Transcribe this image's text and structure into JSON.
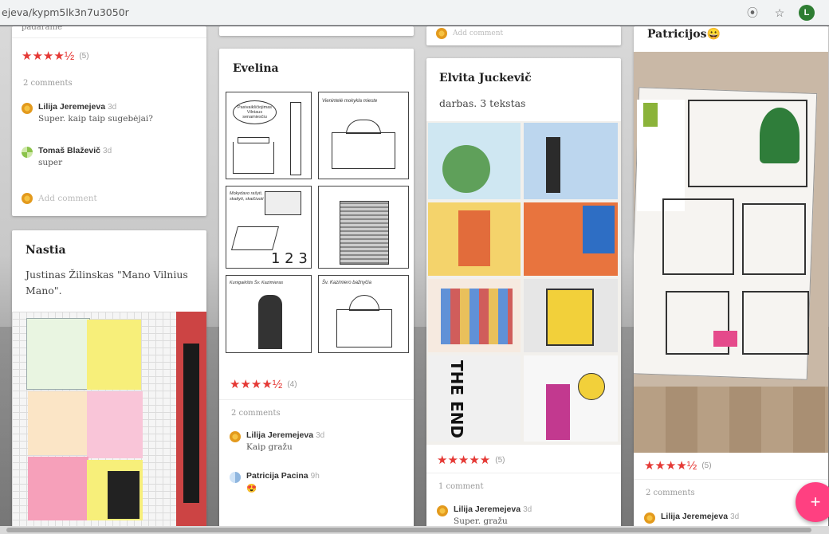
{
  "browser": {
    "url": "ejeva/kypm5lk3n7u3050r",
    "profile_initial": "L",
    "icons": [
      "history-icon",
      "star-icon",
      "profile-avatar"
    ]
  },
  "posts": {
    "top_left": {
      "partial_text": "padaranie",
      "stars": "★★★★½",
      "rating_count": "(5)",
      "comment_count": "2 comments",
      "comments": [
        {
          "author": "Lilija Jeremejeva",
          "time": "3d",
          "text": "Super. kaip taip sugebėjai?"
        },
        {
          "author": "Tomaš Blaževič",
          "time": "3d",
          "text": "super"
        }
      ],
      "add_comment": "Add comment"
    },
    "nastia": {
      "title": "Nastia",
      "text": "Justinas Žilinskas \"Mano Vilnius Mano\"."
    },
    "evelina": {
      "title": "Evelina",
      "panels": [
        "Pasivaikščiojimas Vilniaus senamiesčiu",
        "Vienintelė mokykla mieste",
        "Mokydavo rašyti, skaityti, skaičiuoti",
        "",
        "Kunigaikštis Šv. Kazimieras",
        "Šv. Kazimiero bažnyčia"
      ],
      "stars": "★★★★½",
      "rating_count": "(4)",
      "comment_count": "2 comments",
      "comments": [
        {
          "author": "Lilija Jeremejeva",
          "time": "3d",
          "text": "Kaip gražu"
        },
        {
          "author": "Patricija Pacina",
          "time": "9h",
          "text": "😍"
        }
      ]
    },
    "elvita": {
      "title": "Elvita Juckevič",
      "text": "darbas. 3 tekstas",
      "partial_text": "Add comment",
      "stars": "★★★★★",
      "rating_count": "(5)",
      "comment_count": "1 comment",
      "comments": [
        {
          "author": "Lilija Jeremejeva",
          "time": "3d",
          "text": "Super. gražu"
        }
      ]
    },
    "patricija": {
      "title": "Patricijos😀",
      "stars": "★★★★½",
      "rating_count": "(5)",
      "comment_count": "2 comments",
      "comments": [
        {
          "author": "Lilija Jeremejeva",
          "time": "3d",
          "text": ""
        }
      ]
    }
  },
  "fab": {
    "label": "+"
  },
  "colors": {
    "accent": "#e53935",
    "fab": "#ff4081"
  }
}
